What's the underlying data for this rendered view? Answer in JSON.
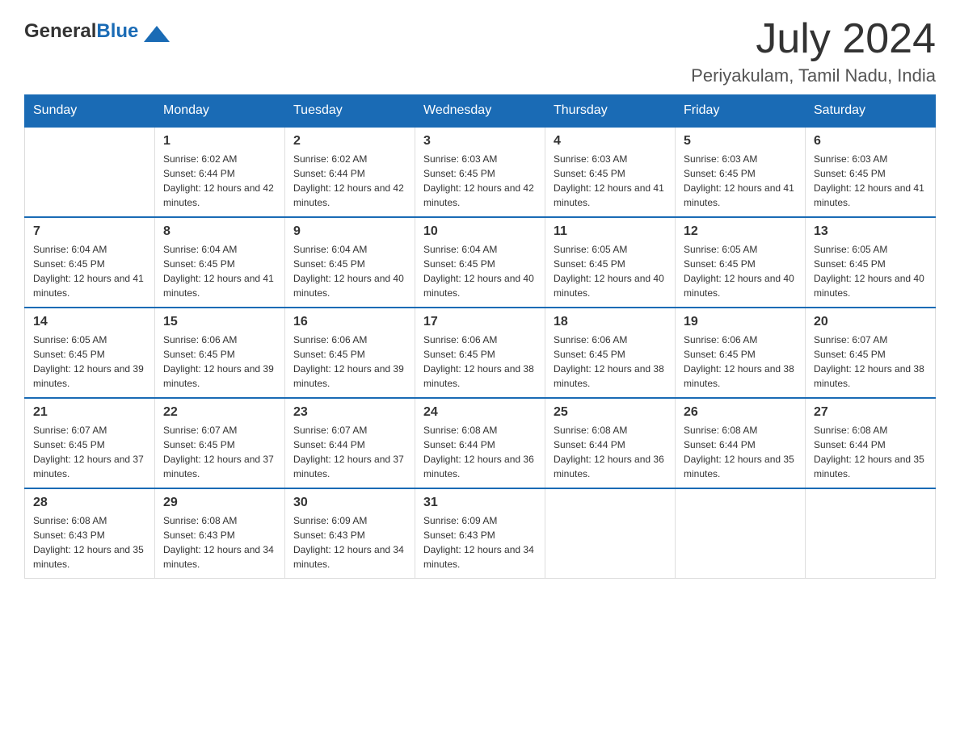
{
  "header": {
    "logo_text_general": "General",
    "logo_text_blue": "Blue",
    "month_title": "July 2024",
    "location": "Periyakulam, Tamil Nadu, India"
  },
  "days_of_week": [
    "Sunday",
    "Monday",
    "Tuesday",
    "Wednesday",
    "Thursday",
    "Friday",
    "Saturday"
  ],
  "weeks": [
    [
      {
        "day": "",
        "sunrise": "",
        "sunset": "",
        "daylight": ""
      },
      {
        "day": "1",
        "sunrise": "Sunrise: 6:02 AM",
        "sunset": "Sunset: 6:44 PM",
        "daylight": "Daylight: 12 hours and 42 minutes."
      },
      {
        "day": "2",
        "sunrise": "Sunrise: 6:02 AM",
        "sunset": "Sunset: 6:44 PM",
        "daylight": "Daylight: 12 hours and 42 minutes."
      },
      {
        "day": "3",
        "sunrise": "Sunrise: 6:03 AM",
        "sunset": "Sunset: 6:45 PM",
        "daylight": "Daylight: 12 hours and 42 minutes."
      },
      {
        "day": "4",
        "sunrise": "Sunrise: 6:03 AM",
        "sunset": "Sunset: 6:45 PM",
        "daylight": "Daylight: 12 hours and 41 minutes."
      },
      {
        "day": "5",
        "sunrise": "Sunrise: 6:03 AM",
        "sunset": "Sunset: 6:45 PM",
        "daylight": "Daylight: 12 hours and 41 minutes."
      },
      {
        "day": "6",
        "sunrise": "Sunrise: 6:03 AM",
        "sunset": "Sunset: 6:45 PM",
        "daylight": "Daylight: 12 hours and 41 minutes."
      }
    ],
    [
      {
        "day": "7",
        "sunrise": "Sunrise: 6:04 AM",
        "sunset": "Sunset: 6:45 PM",
        "daylight": "Daylight: 12 hours and 41 minutes."
      },
      {
        "day": "8",
        "sunrise": "Sunrise: 6:04 AM",
        "sunset": "Sunset: 6:45 PM",
        "daylight": "Daylight: 12 hours and 41 minutes."
      },
      {
        "day": "9",
        "sunrise": "Sunrise: 6:04 AM",
        "sunset": "Sunset: 6:45 PM",
        "daylight": "Daylight: 12 hours and 40 minutes."
      },
      {
        "day": "10",
        "sunrise": "Sunrise: 6:04 AM",
        "sunset": "Sunset: 6:45 PM",
        "daylight": "Daylight: 12 hours and 40 minutes."
      },
      {
        "day": "11",
        "sunrise": "Sunrise: 6:05 AM",
        "sunset": "Sunset: 6:45 PM",
        "daylight": "Daylight: 12 hours and 40 minutes."
      },
      {
        "day": "12",
        "sunrise": "Sunrise: 6:05 AM",
        "sunset": "Sunset: 6:45 PM",
        "daylight": "Daylight: 12 hours and 40 minutes."
      },
      {
        "day": "13",
        "sunrise": "Sunrise: 6:05 AM",
        "sunset": "Sunset: 6:45 PM",
        "daylight": "Daylight: 12 hours and 40 minutes."
      }
    ],
    [
      {
        "day": "14",
        "sunrise": "Sunrise: 6:05 AM",
        "sunset": "Sunset: 6:45 PM",
        "daylight": "Daylight: 12 hours and 39 minutes."
      },
      {
        "day": "15",
        "sunrise": "Sunrise: 6:06 AM",
        "sunset": "Sunset: 6:45 PM",
        "daylight": "Daylight: 12 hours and 39 minutes."
      },
      {
        "day": "16",
        "sunrise": "Sunrise: 6:06 AM",
        "sunset": "Sunset: 6:45 PM",
        "daylight": "Daylight: 12 hours and 39 minutes."
      },
      {
        "day": "17",
        "sunrise": "Sunrise: 6:06 AM",
        "sunset": "Sunset: 6:45 PM",
        "daylight": "Daylight: 12 hours and 38 minutes."
      },
      {
        "day": "18",
        "sunrise": "Sunrise: 6:06 AM",
        "sunset": "Sunset: 6:45 PM",
        "daylight": "Daylight: 12 hours and 38 minutes."
      },
      {
        "day": "19",
        "sunrise": "Sunrise: 6:06 AM",
        "sunset": "Sunset: 6:45 PM",
        "daylight": "Daylight: 12 hours and 38 minutes."
      },
      {
        "day": "20",
        "sunrise": "Sunrise: 6:07 AM",
        "sunset": "Sunset: 6:45 PM",
        "daylight": "Daylight: 12 hours and 38 minutes."
      }
    ],
    [
      {
        "day": "21",
        "sunrise": "Sunrise: 6:07 AM",
        "sunset": "Sunset: 6:45 PM",
        "daylight": "Daylight: 12 hours and 37 minutes."
      },
      {
        "day": "22",
        "sunrise": "Sunrise: 6:07 AM",
        "sunset": "Sunset: 6:45 PM",
        "daylight": "Daylight: 12 hours and 37 minutes."
      },
      {
        "day": "23",
        "sunrise": "Sunrise: 6:07 AM",
        "sunset": "Sunset: 6:44 PM",
        "daylight": "Daylight: 12 hours and 37 minutes."
      },
      {
        "day": "24",
        "sunrise": "Sunrise: 6:08 AM",
        "sunset": "Sunset: 6:44 PM",
        "daylight": "Daylight: 12 hours and 36 minutes."
      },
      {
        "day": "25",
        "sunrise": "Sunrise: 6:08 AM",
        "sunset": "Sunset: 6:44 PM",
        "daylight": "Daylight: 12 hours and 36 minutes."
      },
      {
        "day": "26",
        "sunrise": "Sunrise: 6:08 AM",
        "sunset": "Sunset: 6:44 PM",
        "daylight": "Daylight: 12 hours and 35 minutes."
      },
      {
        "day": "27",
        "sunrise": "Sunrise: 6:08 AM",
        "sunset": "Sunset: 6:44 PM",
        "daylight": "Daylight: 12 hours and 35 minutes."
      }
    ],
    [
      {
        "day": "28",
        "sunrise": "Sunrise: 6:08 AM",
        "sunset": "Sunset: 6:43 PM",
        "daylight": "Daylight: 12 hours and 35 minutes."
      },
      {
        "day": "29",
        "sunrise": "Sunrise: 6:08 AM",
        "sunset": "Sunset: 6:43 PM",
        "daylight": "Daylight: 12 hours and 34 minutes."
      },
      {
        "day": "30",
        "sunrise": "Sunrise: 6:09 AM",
        "sunset": "Sunset: 6:43 PM",
        "daylight": "Daylight: 12 hours and 34 minutes."
      },
      {
        "day": "31",
        "sunrise": "Sunrise: 6:09 AM",
        "sunset": "Sunset: 6:43 PM",
        "daylight": "Daylight: 12 hours and 34 minutes."
      },
      {
        "day": "",
        "sunrise": "",
        "sunset": "",
        "daylight": ""
      },
      {
        "day": "",
        "sunrise": "",
        "sunset": "",
        "daylight": ""
      },
      {
        "day": "",
        "sunrise": "",
        "sunset": "",
        "daylight": ""
      }
    ]
  ]
}
